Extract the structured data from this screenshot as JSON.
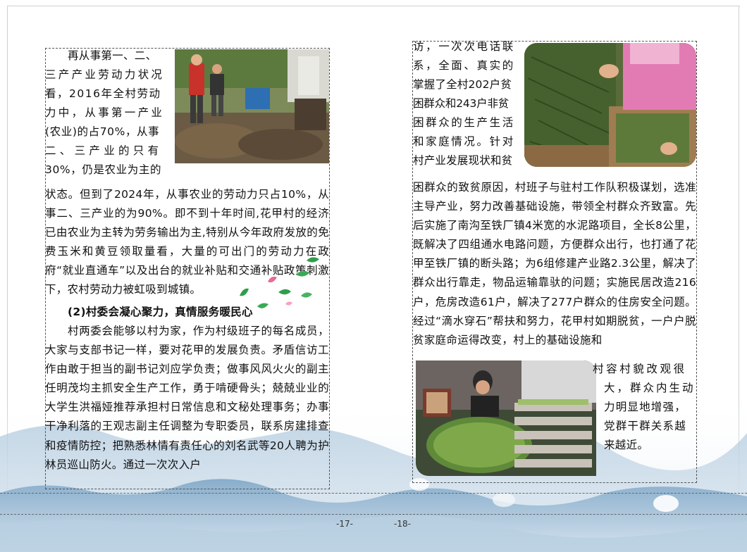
{
  "left_page": {
    "intro_lines": [
      "再从事第一、二、",
      "三产产业劳动力状况",
      "看，2016年全村劳动",
      "力中，从事第一产业",
      "(农业)的占70%，从事",
      "二、三产业的只有",
      "30%，仍是农业为主的"
    ],
    "body_text": "状态。但到了2024年，从事农业的劳动力只占10%，从事二、三产业的为90%。即不到十年时间,花甲村的经济已由农业为主转为劳务输出为主,特别从今年政府发放的免费玉米和黄豆领取量看，大量的可出门的劳动力在政府“就业直通车”以及出台的就业补贴和交通补贴政策刺激下，农村劳动力被虹吸到城镇。",
    "heading": "(2)村委会凝心聚力，真情服务暖民心",
    "body_text2": "村两委会能够以村为家，作为村级班子的每名成员，大家与支部书记一样，要对花甲的发展负责。矛盾信访工作由敢于担当的副书记刘应学负责；做事风风火火的副主任明茂均主抓安全生产工作，勇于啃硬骨头；兢兢业业的大学生洪福娅推荐承担村日常信息和文秘处理事务；办事干净利落的王观志副主任调整为专职委员，联系房建排查和疫情防控；把熟悉林情有责任心的刘名武等20人聘为护林员巡山防火。通过一次次入户",
    "page_number": "-17-"
  },
  "right_page": {
    "intro_lines": [
      "访，一次次电话联",
      "系，全面、真实的",
      "掌握了全村202户贫",
      "困群众和243户非贫",
      "困群众的生产生活",
      "和家庭情况。针对",
      "村产业发展现状和贫"
    ],
    "body_text": "困群众的致贫原因，村班子与驻村工作队积极谋划，选准主导产业，努力改善基础设施，带领全村群众齐致富。先后实施了南沟至铁厂镇4米宽的水泥路项目，全长8公里，既解决了四组通水电路问题，方便群众出行，也打通了花甲至铁厂镇的断头路；为6组修建产业路2.3公里，解决了群众出行靠走，物品运输靠驮的问题；实施民居改造216户，危房改造61户，解决了277户群众的住房安全问题。经过“滴水穿石”帮扶和努力，花甲村如期脱贫，一户户脱贫家庭命运得改变，村上的基础设施和",
    "outro_lines": [
      "村容村貌改观很",
      "大，群众内生动",
      "力明显地增强，",
      "党群干群关系越",
      "来越近。"
    ],
    "page_number": "-18-"
  },
  "photos": {
    "farm_work": "farm-workers-photo",
    "vegetable_crate": "vegetable-harvest-photo",
    "drying_trays": "drying-trays-photo"
  },
  "colors": {
    "leaf_green": "#2e9e4a",
    "petal_pink": "#e86a9a",
    "mountain_blue": "#8fb3cf"
  }
}
